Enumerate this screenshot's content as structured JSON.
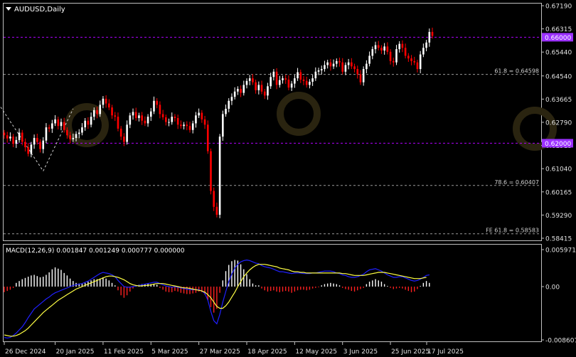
{
  "chart_data": [
    {
      "type": "candlestick",
      "title": "AUDUSD,Daily",
      "symbol": "AUDUSD",
      "timeframe": "Daily",
      "ylim": [
        0.58415,
        0.6719
      ],
      "price_ticks": [
        "0.67190",
        "0.66315",
        "0.65440",
        "0.64540",
        "0.63665",
        "0.62790",
        "0.61915",
        "0.61040",
        "0.60165",
        "0.59290",
        "0.58415"
      ],
      "date_ticks": [
        "26 Dec 2024",
        "20 Jan 2025",
        "11 Feb 2025",
        "5 Mar 2025",
        "27 Mar 2025",
        "18 Apr 2025",
        "12 May 2025",
        "3 Jun 2025",
        "25 Jun 2025",
        "17 Jul 2025"
      ],
      "levels": [
        {
          "label": "0.66000",
          "price": 0.66,
          "style": "dashed",
          "color": "#b000ff",
          "tag": true
        },
        {
          "label": "61.8 = 0.64598",
          "price": 0.64598,
          "style": "dashed",
          "color": "#9a9a9a",
          "tag": false
        },
        {
          "label": "0.62000",
          "price": 0.62,
          "style": "dashed",
          "color": "#b000ff",
          "tag": true
        },
        {
          "label": "78.6 = 0.60407",
          "price": 0.60407,
          "style": "dashed",
          "color": "#9a9a9a",
          "tag": false
        },
        {
          "label": "FE 61.8 = 0.58583",
          "price": 0.58583,
          "style": "dashed",
          "color": "#9a9a9a",
          "tag": false
        }
      ],
      "closes": [
        0.623,
        0.6218,
        0.6225,
        0.6198,
        0.6212,
        0.624,
        0.6205,
        0.6185,
        0.616,
        0.6195,
        0.622,
        0.6205,
        0.6178,
        0.621,
        0.626,
        0.6255,
        0.6275,
        0.629,
        0.6265,
        0.628,
        0.625,
        0.623,
        0.6215,
        0.622,
        0.6235,
        0.624,
        0.626,
        0.6285,
        0.627,
        0.63,
        0.6325,
        0.631,
        0.6345,
        0.6368,
        0.635,
        0.6335,
        0.6305,
        0.63,
        0.6255,
        0.6225,
        0.6205,
        0.627,
        0.6305,
        0.6318,
        0.6295,
        0.6305,
        0.6285,
        0.6275,
        0.63,
        0.632,
        0.636,
        0.6345,
        0.631,
        0.6298,
        0.628,
        0.628,
        0.63,
        0.6295,
        0.627,
        0.6265,
        0.627,
        0.6265,
        0.625,
        0.6275,
        0.6305,
        0.6315,
        0.629,
        0.627,
        0.617,
        0.602,
        0.596,
        0.593,
        0.6225,
        0.631,
        0.633,
        0.636,
        0.6375,
        0.6395,
        0.6405,
        0.639,
        0.642,
        0.6435,
        0.6445,
        0.643,
        0.64,
        0.642,
        0.6395,
        0.638,
        0.6415,
        0.645,
        0.647,
        0.642,
        0.6438,
        0.6445,
        0.644,
        0.641,
        0.6425,
        0.6445,
        0.6468,
        0.644,
        0.6435,
        0.642,
        0.6432,
        0.6445,
        0.647,
        0.6475,
        0.648,
        0.6495,
        0.6505,
        0.649,
        0.65,
        0.651,
        0.6505,
        0.647,
        0.6495,
        0.6505,
        0.649,
        0.648,
        0.646,
        0.643,
        0.648,
        0.65,
        0.653,
        0.6555,
        0.657,
        0.656,
        0.655,
        0.6565,
        0.6545,
        0.651,
        0.6505,
        0.6555,
        0.6575,
        0.656,
        0.653,
        0.652,
        0.651,
        0.6505,
        0.648,
        0.6535,
        0.656,
        0.658,
        0.662,
        0.6605
      ],
      "macd": {
        "label": "MACD(12,26,9)",
        "params": "0.001847 0.001249 0.000777 0.000000",
        "ylim": [
          -0.008607,
          0.005971
        ],
        "ticks": [
          "0.005971",
          "0.00",
          "-0.008607"
        ],
        "histogram": [
          -0.0009,
          -0.0007,
          -0.0005,
          -0.0002,
          0.0006,
          0.0009,
          0.0012,
          0.0014,
          0.0016,
          0.0018,
          0.0019,
          0.0017,
          0.0015,
          0.0016,
          0.0019,
          0.0023,
          0.0028,
          0.0031,
          0.0029,
          0.0027,
          0.0022,
          0.0018,
          0.0013,
          0.0009,
          0.0006,
          0.0005,
          0.0005,
          0.0006,
          0.0008,
          0.001,
          0.0012,
          0.0012,
          0.0013,
          0.0015,
          0.0013,
          0.001,
          0.0006,
          0.0002,
          -0.0006,
          -0.0014,
          -0.0018,
          -0.0014,
          -0.0008,
          -0.0003,
          0.0001,
          0.0003,
          0.0004,
          0.0004,
          0.0005,
          0.0004,
          0.0004,
          0.0003,
          -0.0002,
          -0.0005,
          -0.0008,
          -0.0009,
          -0.0009,
          -0.0007,
          -0.0008,
          -0.001,
          -0.0011,
          -0.0012,
          -0.0012,
          -0.0011,
          -0.001,
          -0.0008,
          -0.0009,
          -0.0013,
          -0.0022,
          -0.0033,
          -0.0042,
          -0.0036,
          -0.001,
          0.001,
          0.0025,
          0.0035,
          0.0041,
          0.0043,
          0.0042,
          0.0036,
          0.0028,
          0.002,
          0.0012,
          0.0005,
          0.0002,
          0.0002,
          -0.0003,
          -0.0006,
          -0.0008,
          -0.0007,
          -0.0006,
          -0.0008,
          -0.0009,
          -0.0008,
          -0.0007,
          -0.0008,
          -0.001,
          -0.0008,
          -0.0006,
          -0.0005,
          -0.0005,
          -0.0006,
          -0.0005,
          -0.0003,
          -0.0002,
          -0.0001,
          0.0002,
          0.0004,
          0.0005,
          0.0006,
          0.0005,
          0.0004,
          0.0002,
          -0.0002,
          -0.0004,
          -0.0005,
          -0.0007,
          -0.0008,
          -0.0006,
          -0.0004,
          -0.0002,
          0.0004,
          0.0008,
          0.001,
          0.0012,
          0.001,
          0.0008,
          0.0004,
          0.0001,
          -0.0002,
          -0.0004,
          -0.0003,
          -0.0002,
          -0.0003,
          -0.0005,
          -0.0007,
          -0.0009,
          -0.0008,
          -0.0004,
          0.0001,
          0.0006,
          0.0009,
          0.0006
        ],
        "macd_line": [
          -0.0082,
          -0.0083,
          -0.0082,
          -0.0079,
          -0.0075,
          -0.007,
          -0.0065,
          -0.0058,
          -0.005,
          -0.0043,
          -0.0036,
          -0.0032,
          -0.0028,
          -0.0024,
          -0.002,
          -0.0017,
          -0.0013,
          -0.001,
          -0.0008,
          -0.0006,
          -0.0004,
          -0.0002,
          0.0,
          0.0002,
          0.0003,
          0.0004,
          0.0005,
          0.0007,
          0.0009,
          0.0012,
          0.0015,
          0.0018,
          0.0021,
          0.0023,
          0.0022,
          0.0021,
          0.0019,
          0.0016,
          0.001,
          0.0005,
          0.0,
          -0.0001,
          -0.0001,
          0.0,
          0.0001,
          0.0002,
          0.0003,
          0.0004,
          0.0005,
          0.0006,
          0.0007,
          0.0007,
          0.0005,
          0.0003,
          0.0001,
          0.0,
          -0.0001,
          0.0,
          -0.0001,
          -0.0002,
          -0.0003,
          -0.0004,
          -0.0005,
          -0.0005,
          -0.0005,
          -0.0005,
          -0.0007,
          -0.0011,
          -0.0022,
          -0.004,
          -0.0055,
          -0.006,
          -0.0045,
          -0.0025,
          -0.0008,
          0.0008,
          0.002,
          0.003,
          0.0036,
          0.004,
          0.0042,
          0.0043,
          0.0042,
          0.004,
          0.0038,
          0.0037,
          0.0034,
          0.0032,
          0.0031,
          0.003,
          0.0028,
          0.0026,
          0.0024,
          0.0024,
          0.0023,
          0.0022,
          0.0021,
          0.0022,
          0.0022,
          0.0022,
          0.0021,
          0.0021,
          0.0021,
          0.0022,
          0.0022,
          0.0023,
          0.0024,
          0.0025,
          0.0025,
          0.0025,
          0.0024,
          0.0022,
          0.0021,
          0.0019,
          0.0018,
          0.0016,
          0.0015,
          0.0015,
          0.0016,
          0.0018,
          0.002,
          0.0024,
          0.0027,
          0.0028,
          0.0029,
          0.0027,
          0.0025,
          0.0022,
          0.0019,
          0.0017,
          0.0015,
          0.0015,
          0.0016,
          0.0016,
          0.0014,
          0.0012,
          0.001,
          0.0009,
          0.001,
          0.0012,
          0.0015,
          0.0018,
          0.0019
        ],
        "signal_line": [
          -0.0078,
          -0.0079,
          -0.008,
          -0.008,
          -0.0079,
          -0.0077,
          -0.0074,
          -0.0071,
          -0.0067,
          -0.0062,
          -0.0057,
          -0.0052,
          -0.0047,
          -0.0042,
          -0.0038,
          -0.0034,
          -0.003,
          -0.0026,
          -0.0022,
          -0.0019,
          -0.0016,
          -0.0013,
          -0.001,
          -0.0007,
          -0.0004,
          -0.0002,
          0.0,
          0.0002,
          0.0004,
          0.0006,
          0.0008,
          0.001,
          0.0012,
          0.0014,
          0.0016,
          0.0017,
          0.0017,
          0.0016,
          0.0015,
          0.0013,
          0.0011,
          0.0008,
          0.0005,
          0.0003,
          0.0002,
          0.0001,
          0.0001,
          0.0002,
          0.0002,
          0.0003,
          0.0004,
          0.0005,
          0.0005,
          0.0005,
          0.0004,
          0.0003,
          0.0002,
          0.0001,
          0.0,
          -0.0001,
          -0.0002,
          -0.0002,
          -0.0003,
          -0.0004,
          -0.0005,
          -0.0006,
          -0.0007,
          -0.0009,
          -0.0013,
          -0.0018,
          -0.0025,
          -0.0032,
          -0.0035,
          -0.0035,
          -0.0031,
          -0.0025,
          -0.0017,
          -0.0009,
          0.0,
          0.0008,
          0.0016,
          0.0022,
          0.0027,
          0.0031,
          0.0034,
          0.0036,
          0.0036,
          0.0036,
          0.0035,
          0.0034,
          0.0033,
          0.0032,
          0.003,
          0.0029,
          0.0028,
          0.0027,
          0.0025,
          0.0024,
          0.0024,
          0.0023,
          0.0023,
          0.0022,
          0.0022,
          0.0022,
          0.0022,
          0.0022,
          0.0022,
          0.0022,
          0.0022,
          0.0022,
          0.0022,
          0.0022,
          0.0022,
          0.0021,
          0.0021,
          0.002,
          0.0019,
          0.0018,
          0.0018,
          0.0018,
          0.0018,
          0.0019,
          0.002,
          0.0021,
          0.0022,
          0.0023,
          0.0023,
          0.0023,
          0.0022,
          0.0021,
          0.002,
          0.0019,
          0.0018,
          0.0017,
          0.0016,
          0.0015,
          0.0014,
          0.0013,
          0.0013,
          0.0013,
          0.0014,
          0.0015
        ]
      },
      "colors": {
        "background": "#000000",
        "bull": "#ffffff",
        "bear": "#ff0000",
        "axis": "#c8c8c8",
        "macd": "#2020ff",
        "signal": "#ffff44",
        "hist_pos": "#ffffff",
        "hist_neg": "#ff2020",
        "tag_bg": "#9b30ff"
      }
    }
  ]
}
